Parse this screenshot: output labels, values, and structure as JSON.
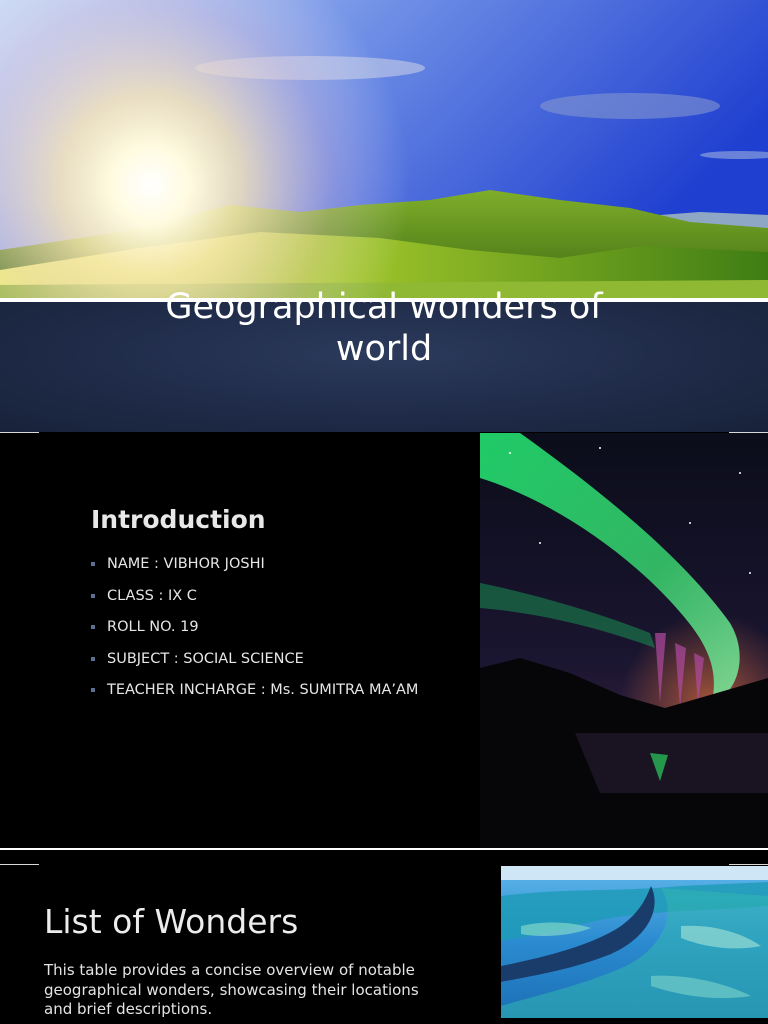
{
  "slide1": {
    "title_line1": "Geographical wonders of",
    "title_line2": "world",
    "hero_image": "sunrise-over-green-hills"
  },
  "slide2": {
    "heading": "Introduction",
    "items": [
      "NAME : VIBHOR JOSHI",
      "CLASS : IX C",
      "ROLL NO. 19",
      "SUBJECT : SOCIAL SCIENCE",
      "TEACHER INCHARGE : Ms. SUMITRA MA’AM"
    ],
    "side_image": "aurora-borealis-over-lake",
    "bullet_color": "#5a6f92"
  },
  "slide3": {
    "heading": "List of Wonders",
    "description": "This table provides a concise overview of notable geographical wonders, showcasing their locations and brief descriptions.",
    "side_image": "coral-reef-aerial"
  },
  "colors": {
    "title_band": "#1f2b48",
    "slide_bg": "#000000",
    "text": "#e6e6e6"
  }
}
